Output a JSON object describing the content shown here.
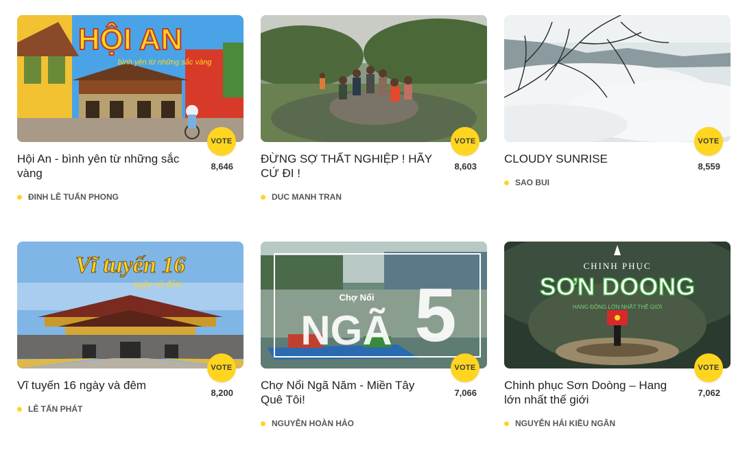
{
  "accent_color": "#ffd51f",
  "vote_label": "VOTE",
  "cards": [
    {
      "title": "Hội An - bình yên từ những sắc vàng",
      "author": "ĐINH LÊ TUẤN PHONG",
      "votes": "8,646",
      "thumb_heading": "HỘI AN",
      "thumb_sub": "bình yên từ những sắc vàng"
    },
    {
      "title": "ĐỪNG SỢ THẤT NGHIỆP ! HÃY CỨ ĐI !",
      "author": "DUC MANH TRAN",
      "votes": "8,603"
    },
    {
      "title": "CLOUDY SUNRISE",
      "author": "SAO BUI",
      "votes": "8,559"
    },
    {
      "title": "Vĩ tuyến 16 ngày và đêm",
      "author": "LÊ TẤN PHÁT",
      "votes": "8,200",
      "thumb_heading": "Vĩ tuyến 16",
      "thumb_sub": "ngày và đêm"
    },
    {
      "title": "Chợ Nổi Ngã Năm - Miền Tây Quê Tôi!",
      "author": "NGUYỄN HOÀN HẢO",
      "votes": "7,066",
      "thumb_heading": "Chợ Nổi",
      "thumb_big": "NGÃ",
      "thumb_num": "5"
    },
    {
      "title": "Chinh phục Sơn Doòng – Hang lớn nhất thế giới",
      "author": "NGUYỄN HẢI KIỀU NGÂN",
      "votes": "7,062",
      "thumb_heading": "CHINH PHỤC",
      "thumb_big": "SƠN DOONG",
      "thumb_sub": "HANG ĐỘNG LỚN NHẤT THẾ GIỚI"
    }
  ]
}
